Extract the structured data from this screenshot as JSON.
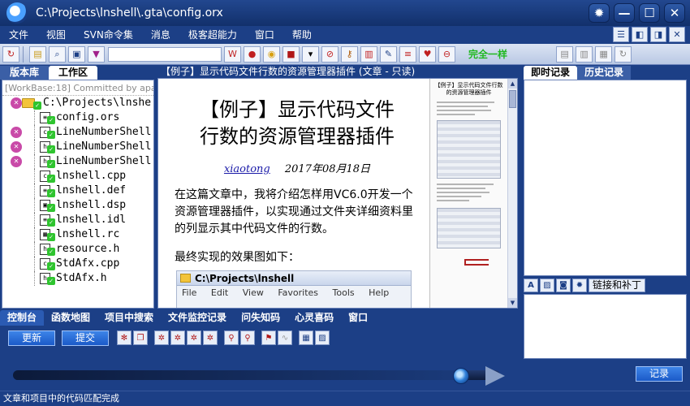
{
  "window": {
    "title": "C:\\Projects\\lnshell\\.gta\\config.orx"
  },
  "menu": [
    "文件",
    "视图",
    "SVN命令集",
    "消息",
    "极客超能力",
    "窗口",
    "帮助"
  ],
  "toolbar": {
    "match_label": "完全一样"
  },
  "left": {
    "tabs": [
      "版本库",
      "工作区"
    ],
    "commit_line": "[WorkBase:18] Committed by apac...",
    "root": "C:\\Projects\\lnshe",
    "files": [
      {
        "name": "config.ors",
        "icon": "≡",
        "xmark": false
      },
      {
        "name": "LineNumberShell",
        "icon": "c",
        "xmark": true
      },
      {
        "name": "LineNumberShell",
        "icon": "h",
        "xmark": true
      },
      {
        "name": "LineNumberShell",
        "icon": "h",
        "xmark": true
      },
      {
        "name": "lnshell.cpp",
        "icon": "c",
        "xmark": false
      },
      {
        "name": "lnshell.def",
        "icon": "≡",
        "xmark": false
      },
      {
        "name": "lnshell.dsp",
        "icon": "▣",
        "xmark": false
      },
      {
        "name": "lnshell.idl",
        "icon": "≡",
        "xmark": false
      },
      {
        "name": "lnshell.rc",
        "icon": "▦",
        "xmark": false
      },
      {
        "name": "resource.h",
        "icon": "h",
        "xmark": false
      },
      {
        "name": "StdAfx.cpp",
        "icon": "c",
        "xmark": false
      },
      {
        "name": "StdAfx.h",
        "icon": "h",
        "xmark": false
      }
    ]
  },
  "doc": {
    "header": "【例子】显示代码文件行数的资源管理器插件 (文章 - 只读)",
    "title_line1": "【例子】显示代码文件",
    "title_line2": "行数的资源管理器插件",
    "author": "xiaotong",
    "date": "2017年08月18日",
    "para1": "在这篇文章中，我将介绍怎样用VC6.0开发一个资源管理器插件，以实现通过文件夹详细资料里的列显示其中代码文件的行数。",
    "para2": "最终实现的效果图如下：",
    "shot_path": "C:\\Projects\\lnshell",
    "shot_menu": [
      "File",
      "Edit",
      "View",
      "Favorites",
      "Tools",
      "Help"
    ],
    "mini_title": "【例子】显示代码文件行数的资源管理器插件"
  },
  "right": {
    "tabs": [
      "即时记录",
      "历史记录"
    ],
    "link_patch_label": "链接和补丁",
    "record_label": "记录"
  },
  "bottom": {
    "tabs": [
      "控制台",
      "函数地图",
      "项目中搜索",
      "文件监控记录",
      "问失知码",
      "心灵喜码",
      "窗口"
    ],
    "update_label": "更新",
    "commit_label": "提交",
    "progress": 0.92
  },
  "status": {
    "text": "文章和项目中的代码匹配完成"
  }
}
